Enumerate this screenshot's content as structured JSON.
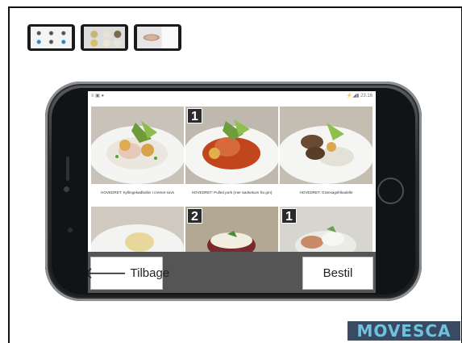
{
  "thumbnails": [
    {
      "name": "thumbnail-menu-icons"
    },
    {
      "name": "thumbnail-dish-grid"
    },
    {
      "name": "thumbnail-dish-detail"
    }
  ],
  "status_bar": {
    "left": "≡ ▣ ●",
    "right": "⚡◢▮ 23:16"
  },
  "dishes": [
    {
      "caption": "HOVEDRET: Kyllingekødboller i cremet sovs",
      "badge": ""
    },
    {
      "caption": "HOVEDRET: Pulled pork (mer sødsekum fra grn)",
      "badge": "1"
    },
    {
      "caption": "HOVEDRET: Grønsagsfrikadelle",
      "badge": ""
    },
    {
      "caption": "",
      "badge": ""
    },
    {
      "caption": "",
      "badge": "2"
    },
    {
      "caption": "",
      "badge": "1"
    }
  ],
  "buttons": {
    "back_label": "Tilbage",
    "back_arrow": "🡐",
    "order_label": "Bestil"
  },
  "logo": {
    "text": "MOVESCA"
  },
  "colors": {
    "bottom_bar": "#555555",
    "badge_bg": "#2b2b2b",
    "logo_bg": "#3b4a63",
    "logo_text": "#6fc3df"
  }
}
